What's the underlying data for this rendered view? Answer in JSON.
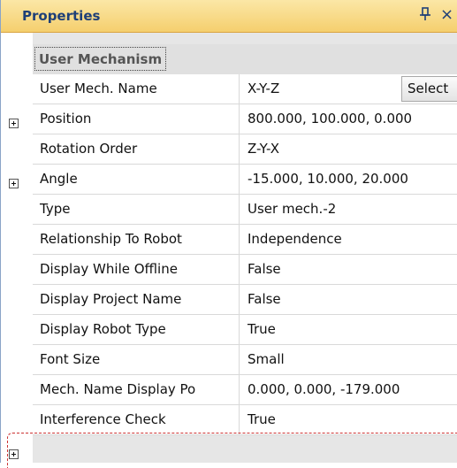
{
  "window": {
    "title": "Properties",
    "pin_glyph": "p",
    "close_glyph": "×"
  },
  "category": {
    "label": "User Mechanism"
  },
  "properties": [
    {
      "name": "User Mech. Name",
      "value": "X-Y-Z",
      "button": "Select"
    },
    {
      "name": "Position",
      "value": "800.000, 100.000, 0.000",
      "expandable": true
    },
    {
      "name": "Rotation Order",
      "value": "Z-Y-X"
    },
    {
      "name": "Angle",
      "value": "-15.000, 10.000, 20.000",
      "expandable": true
    },
    {
      "name": "Type",
      "value": "User mech.-2"
    },
    {
      "name": "Relationship To Robot",
      "value": "Independence"
    },
    {
      "name": "Display While Offline",
      "value": "False"
    },
    {
      "name": "Display Project Name",
      "value": "False"
    },
    {
      "name": "Display Robot Type",
      "value": "True"
    },
    {
      "name": "Font Size",
      "value": "Small"
    },
    {
      "name": "Mech. Name Display Po",
      "value": "0.000, 0.000, -179.000",
      "expandable": true
    },
    {
      "name": "Interference Check",
      "value": "True"
    }
  ],
  "icons": {
    "pin": "pin-icon",
    "close": "close-icon",
    "expand": "plus-box-icon"
  },
  "colors": {
    "titlebar": "#f5cf6e",
    "title_text": "#1e3f77",
    "highlight_dash": "#cc3333"
  }
}
